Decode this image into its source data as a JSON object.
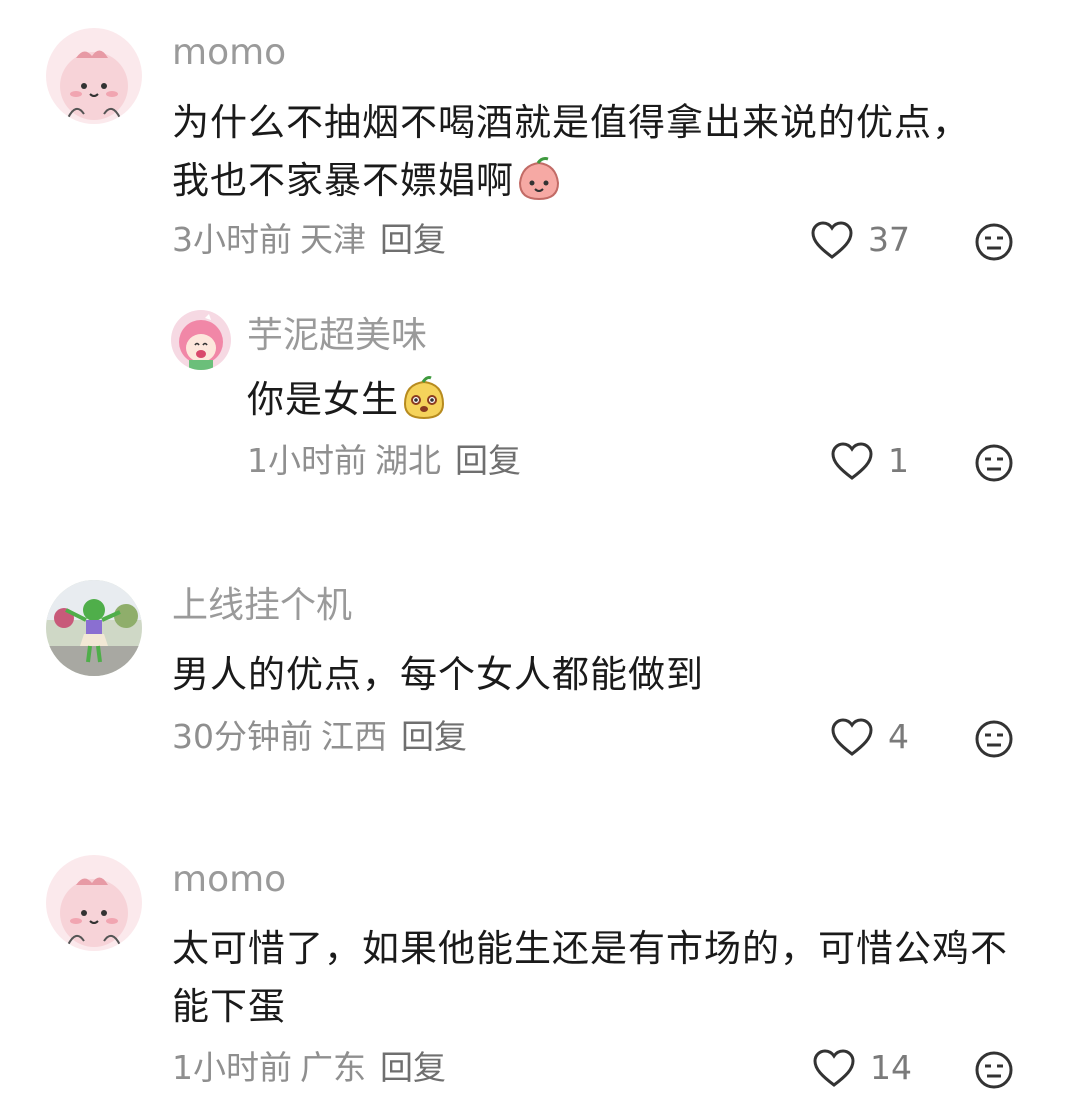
{
  "comments": [
    {
      "user": "momo",
      "text": "为什么不抽烟不喝酒就是值得拿出来说的优点，我也不家暴不嫖娼啊",
      "emoji": "peach-face-emoji",
      "time": "3小时前",
      "location": "天津",
      "reply": "回复",
      "likes": "37",
      "avatar": "pink-bun-avatar"
    },
    {
      "user": "芋泥超美味",
      "text": "你是女生",
      "emoji": "yellow-pear-face-emoji",
      "time": "1小时前",
      "location": "湖北",
      "reply": "回复",
      "likes": "1",
      "avatar": "pink-hair-girl-avatar"
    },
    {
      "user": "上线挂个机",
      "text": "男人的优点，每个女人都能做到",
      "time": "30分钟前",
      "location": "江西",
      "reply": "回复",
      "likes": "4",
      "avatar": "frog-costume-photo-avatar"
    },
    {
      "user": "momo",
      "text": "太可惜了，如果他能生还是有市场的，可惜公鸡不能下蛋",
      "time": "1小时前",
      "location": "广东",
      "reply": "回复",
      "likes": "14",
      "avatar": "pink-bun-avatar"
    }
  ],
  "icons": {
    "like": "heart-outline-icon",
    "dislike": "meh-face-icon"
  },
  "colors": {
    "username": "#9a9a9a",
    "text": "#1a1a1a",
    "meta": "#8f8f8f"
  }
}
